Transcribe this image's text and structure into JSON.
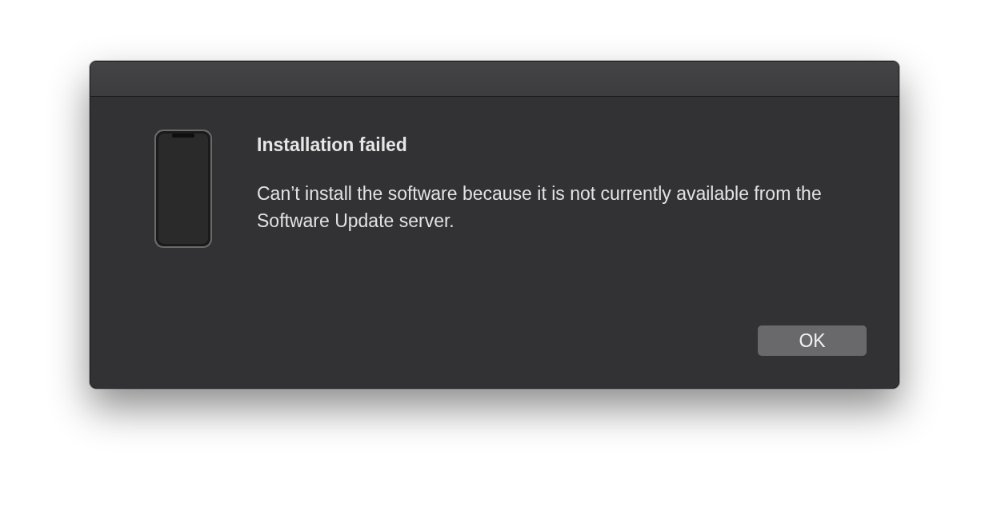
{
  "dialog": {
    "title": "Installation failed",
    "message": "Can’t install the software because it is not currently available from the Software Update server.",
    "buttons": [
      {
        "label": "OK"
      }
    ]
  }
}
